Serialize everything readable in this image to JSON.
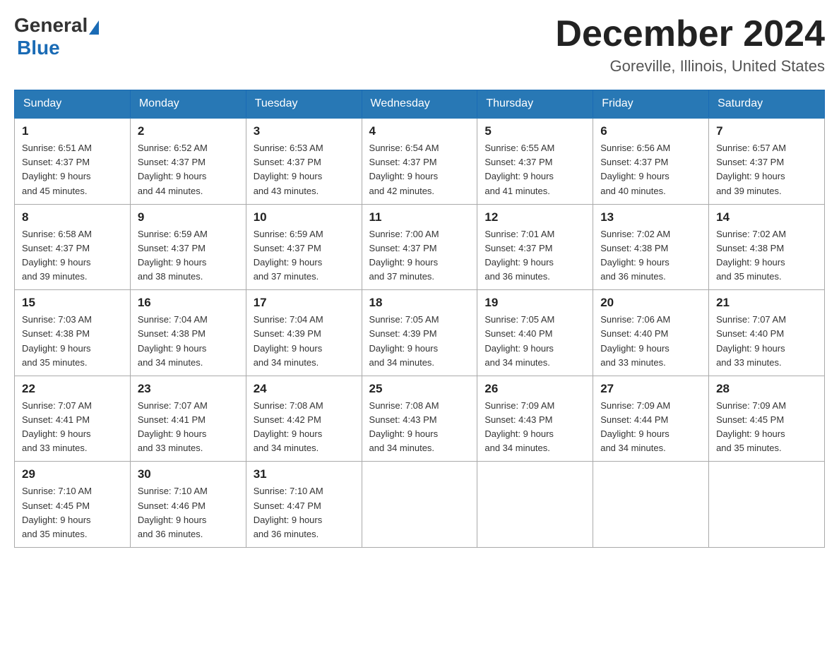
{
  "header": {
    "logo_general": "General",
    "logo_blue": "Blue",
    "month_title": "December 2024",
    "location": "Goreville, Illinois, United States"
  },
  "days_of_week": [
    "Sunday",
    "Monday",
    "Tuesday",
    "Wednesday",
    "Thursday",
    "Friday",
    "Saturday"
  ],
  "weeks": [
    [
      {
        "day": "1",
        "sunrise": "Sunrise: 6:51 AM",
        "sunset": "Sunset: 4:37 PM",
        "daylight": "Daylight: 9 hours",
        "daylight2": "and 45 minutes."
      },
      {
        "day": "2",
        "sunrise": "Sunrise: 6:52 AM",
        "sunset": "Sunset: 4:37 PM",
        "daylight": "Daylight: 9 hours",
        "daylight2": "and 44 minutes."
      },
      {
        "day": "3",
        "sunrise": "Sunrise: 6:53 AM",
        "sunset": "Sunset: 4:37 PM",
        "daylight": "Daylight: 9 hours",
        "daylight2": "and 43 minutes."
      },
      {
        "day": "4",
        "sunrise": "Sunrise: 6:54 AM",
        "sunset": "Sunset: 4:37 PM",
        "daylight": "Daylight: 9 hours",
        "daylight2": "and 42 minutes."
      },
      {
        "day": "5",
        "sunrise": "Sunrise: 6:55 AM",
        "sunset": "Sunset: 4:37 PM",
        "daylight": "Daylight: 9 hours",
        "daylight2": "and 41 minutes."
      },
      {
        "day": "6",
        "sunrise": "Sunrise: 6:56 AM",
        "sunset": "Sunset: 4:37 PM",
        "daylight": "Daylight: 9 hours",
        "daylight2": "and 40 minutes."
      },
      {
        "day": "7",
        "sunrise": "Sunrise: 6:57 AM",
        "sunset": "Sunset: 4:37 PM",
        "daylight": "Daylight: 9 hours",
        "daylight2": "and 39 minutes."
      }
    ],
    [
      {
        "day": "8",
        "sunrise": "Sunrise: 6:58 AM",
        "sunset": "Sunset: 4:37 PM",
        "daylight": "Daylight: 9 hours",
        "daylight2": "and 39 minutes."
      },
      {
        "day": "9",
        "sunrise": "Sunrise: 6:59 AM",
        "sunset": "Sunset: 4:37 PM",
        "daylight": "Daylight: 9 hours",
        "daylight2": "and 38 minutes."
      },
      {
        "day": "10",
        "sunrise": "Sunrise: 6:59 AM",
        "sunset": "Sunset: 4:37 PM",
        "daylight": "Daylight: 9 hours",
        "daylight2": "and 37 minutes."
      },
      {
        "day": "11",
        "sunrise": "Sunrise: 7:00 AM",
        "sunset": "Sunset: 4:37 PM",
        "daylight": "Daylight: 9 hours",
        "daylight2": "and 37 minutes."
      },
      {
        "day": "12",
        "sunrise": "Sunrise: 7:01 AM",
        "sunset": "Sunset: 4:37 PM",
        "daylight": "Daylight: 9 hours",
        "daylight2": "and 36 minutes."
      },
      {
        "day": "13",
        "sunrise": "Sunrise: 7:02 AM",
        "sunset": "Sunset: 4:38 PM",
        "daylight": "Daylight: 9 hours",
        "daylight2": "and 36 minutes."
      },
      {
        "day": "14",
        "sunrise": "Sunrise: 7:02 AM",
        "sunset": "Sunset: 4:38 PM",
        "daylight": "Daylight: 9 hours",
        "daylight2": "and 35 minutes."
      }
    ],
    [
      {
        "day": "15",
        "sunrise": "Sunrise: 7:03 AM",
        "sunset": "Sunset: 4:38 PM",
        "daylight": "Daylight: 9 hours",
        "daylight2": "and 35 minutes."
      },
      {
        "day": "16",
        "sunrise": "Sunrise: 7:04 AM",
        "sunset": "Sunset: 4:38 PM",
        "daylight": "Daylight: 9 hours",
        "daylight2": "and 34 minutes."
      },
      {
        "day": "17",
        "sunrise": "Sunrise: 7:04 AM",
        "sunset": "Sunset: 4:39 PM",
        "daylight": "Daylight: 9 hours",
        "daylight2": "and 34 minutes."
      },
      {
        "day": "18",
        "sunrise": "Sunrise: 7:05 AM",
        "sunset": "Sunset: 4:39 PM",
        "daylight": "Daylight: 9 hours",
        "daylight2": "and 34 minutes."
      },
      {
        "day": "19",
        "sunrise": "Sunrise: 7:05 AM",
        "sunset": "Sunset: 4:40 PM",
        "daylight": "Daylight: 9 hours",
        "daylight2": "and 34 minutes."
      },
      {
        "day": "20",
        "sunrise": "Sunrise: 7:06 AM",
        "sunset": "Sunset: 4:40 PM",
        "daylight": "Daylight: 9 hours",
        "daylight2": "and 33 minutes."
      },
      {
        "day": "21",
        "sunrise": "Sunrise: 7:07 AM",
        "sunset": "Sunset: 4:40 PM",
        "daylight": "Daylight: 9 hours",
        "daylight2": "and 33 minutes."
      }
    ],
    [
      {
        "day": "22",
        "sunrise": "Sunrise: 7:07 AM",
        "sunset": "Sunset: 4:41 PM",
        "daylight": "Daylight: 9 hours",
        "daylight2": "and 33 minutes."
      },
      {
        "day": "23",
        "sunrise": "Sunrise: 7:07 AM",
        "sunset": "Sunset: 4:41 PM",
        "daylight": "Daylight: 9 hours",
        "daylight2": "and 33 minutes."
      },
      {
        "day": "24",
        "sunrise": "Sunrise: 7:08 AM",
        "sunset": "Sunset: 4:42 PM",
        "daylight": "Daylight: 9 hours",
        "daylight2": "and 34 minutes."
      },
      {
        "day": "25",
        "sunrise": "Sunrise: 7:08 AM",
        "sunset": "Sunset: 4:43 PM",
        "daylight": "Daylight: 9 hours",
        "daylight2": "and 34 minutes."
      },
      {
        "day": "26",
        "sunrise": "Sunrise: 7:09 AM",
        "sunset": "Sunset: 4:43 PM",
        "daylight": "Daylight: 9 hours",
        "daylight2": "and 34 minutes."
      },
      {
        "day": "27",
        "sunrise": "Sunrise: 7:09 AM",
        "sunset": "Sunset: 4:44 PM",
        "daylight": "Daylight: 9 hours",
        "daylight2": "and 34 minutes."
      },
      {
        "day": "28",
        "sunrise": "Sunrise: 7:09 AM",
        "sunset": "Sunset: 4:45 PM",
        "daylight": "Daylight: 9 hours",
        "daylight2": "and 35 minutes."
      }
    ],
    [
      {
        "day": "29",
        "sunrise": "Sunrise: 7:10 AM",
        "sunset": "Sunset: 4:45 PM",
        "daylight": "Daylight: 9 hours",
        "daylight2": "and 35 minutes."
      },
      {
        "day": "30",
        "sunrise": "Sunrise: 7:10 AM",
        "sunset": "Sunset: 4:46 PM",
        "daylight": "Daylight: 9 hours",
        "daylight2": "and 36 minutes."
      },
      {
        "day": "31",
        "sunrise": "Sunrise: 7:10 AM",
        "sunset": "Sunset: 4:47 PM",
        "daylight": "Daylight: 9 hours",
        "daylight2": "and 36 minutes."
      },
      null,
      null,
      null,
      null
    ]
  ],
  "colors": {
    "header_bg": "#2878b5",
    "header_text": "#ffffff",
    "border": "#aaaaaa",
    "text": "#333333"
  }
}
